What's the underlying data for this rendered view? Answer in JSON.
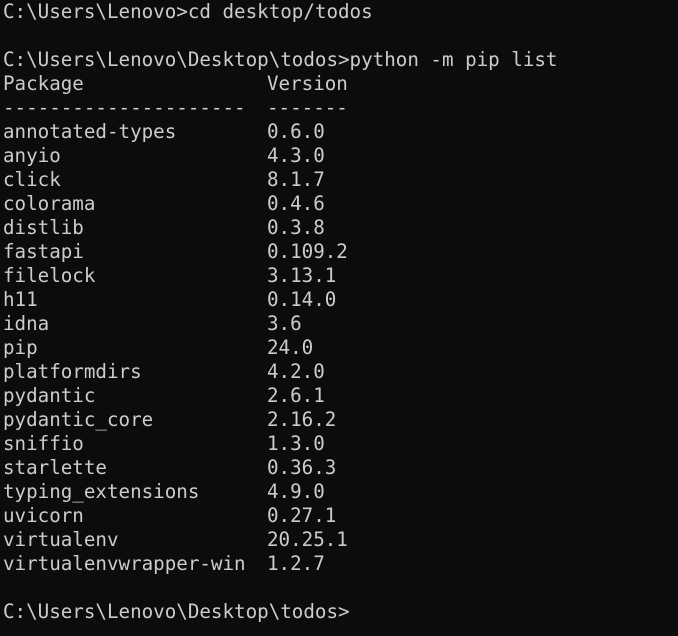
{
  "terminal": {
    "cmd1": "C:\\Users\\Lenovo>cd desktop/todos",
    "cmd2": "C:\\Users\\Lenovo\\Desktop\\todos>python -m pip list",
    "header": {
      "package": "Package",
      "version": "Version"
    },
    "rule": {
      "package": "---------------------",
      "version": "-------"
    },
    "packages": [
      {
        "name": "annotated-types",
        "version": "0.6.0"
      },
      {
        "name": "anyio",
        "version": "4.3.0"
      },
      {
        "name": "click",
        "version": "8.1.7"
      },
      {
        "name": "colorama",
        "version": "0.4.6"
      },
      {
        "name": "distlib",
        "version": "0.3.8"
      },
      {
        "name": "fastapi",
        "version": "0.109.2"
      },
      {
        "name": "filelock",
        "version": "3.13.1"
      },
      {
        "name": "h11",
        "version": "0.14.0"
      },
      {
        "name": "idna",
        "version": "3.6"
      },
      {
        "name": "pip",
        "version": "24.0"
      },
      {
        "name": "platformdirs",
        "version": "4.2.0"
      },
      {
        "name": "pydantic",
        "version": "2.6.1"
      },
      {
        "name": "pydantic_core",
        "version": "2.16.2"
      },
      {
        "name": "sniffio",
        "version": "1.3.0"
      },
      {
        "name": "starlette",
        "version": "0.36.3"
      },
      {
        "name": "typing_extensions",
        "version": "4.9.0"
      },
      {
        "name": "uvicorn",
        "version": "0.27.1"
      },
      {
        "name": "virtualenv",
        "version": "20.25.1"
      },
      {
        "name": "virtualenvwrapper-win",
        "version": "1.2.7"
      }
    ],
    "prompt": "C:\\Users\\Lenovo\\Desktop\\todos>"
  }
}
